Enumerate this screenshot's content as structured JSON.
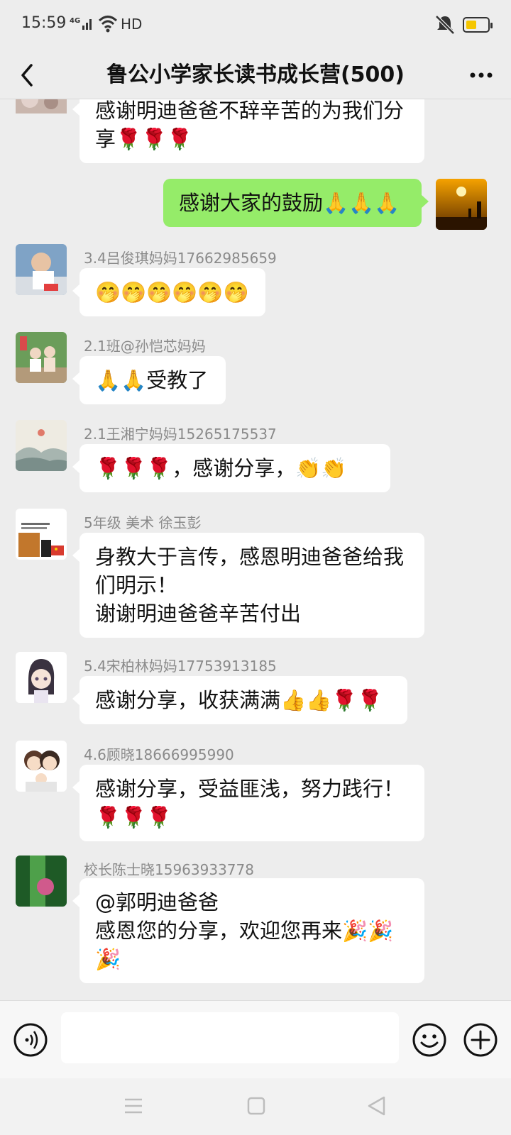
{
  "status": {
    "time": "15:59",
    "network": "4G",
    "hd": "HD"
  },
  "header": {
    "title": "鲁公小学家长读书成长营(500)"
  },
  "messages": [
    {
      "sender": "",
      "text": "感谢明迪爸爸不辞辛苦的为我们分\n享🌹🌹🌹",
      "direction": "in"
    },
    {
      "sender": "",
      "text": "感谢大家的鼓励🙏🙏🙏",
      "direction": "out"
    },
    {
      "sender": "3.4吕俊琪妈妈17662985659",
      "text": "🤭🤭🤭🤭🤭🤭",
      "direction": "in"
    },
    {
      "sender": "2.1班@孙恺芯妈妈",
      "text": "🙏🙏受教了",
      "direction": "in"
    },
    {
      "sender": "2.1王湘宁妈妈15265175537",
      "text": "🌹🌹🌹，感谢分享，👏👏",
      "direction": "in"
    },
    {
      "sender": "5年级 美术 徐玉彭",
      "text": "身教大于言传，感恩明迪爸爸给我\n们明示！\n谢谢明迪爸爸辛苦付出",
      "direction": "in"
    },
    {
      "sender": "5.4宋柏林妈妈17753913185",
      "text": "感谢分享，收获满满👍👍🌹🌹",
      "direction": "in"
    },
    {
      "sender": "4.6顾晓18666995990",
      "text": "感谢分享，受益匪浅，努力践行！\n🌹🌹🌹",
      "direction": "in"
    },
    {
      "sender": "校长陈士晓15963933778",
      "text": "@郭明迪爸爸\n感恩您的分享，欢迎您再来🎉🎉\n🎉",
      "direction": "in"
    }
  ],
  "input": {
    "placeholder": ""
  },
  "colors": {
    "outgoing_bubble": "#95ec69",
    "incoming_bubble": "#ffffff",
    "background": "#ededed"
  }
}
